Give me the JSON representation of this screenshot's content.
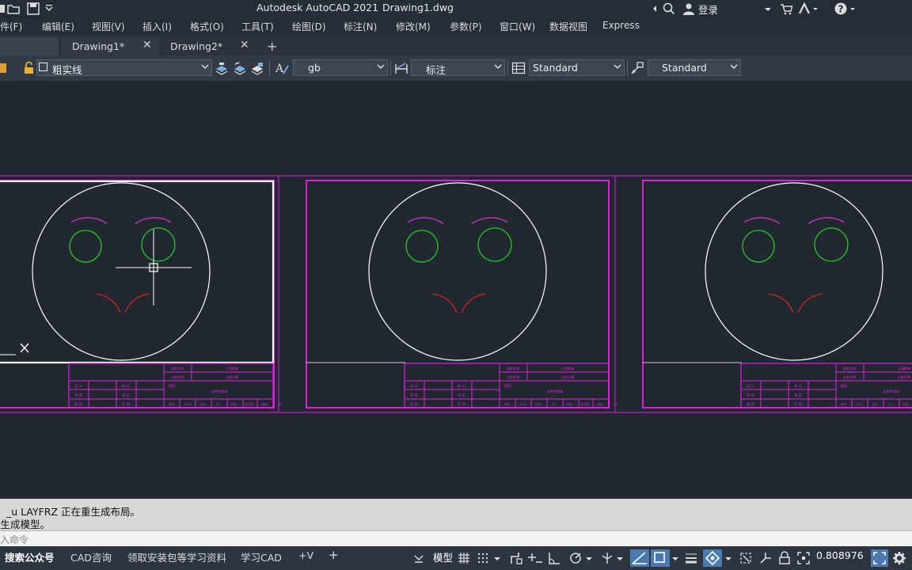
{
  "titlebar": {
    "app_title": "Autodesk AutoCAD 2021",
    "file_name": "Drawing1.dwg",
    "login_label": "登录"
  },
  "menu": {
    "items": [
      "文件(F)",
      "编辑(E)",
      "视图(V)",
      "插入(I)",
      "格式(O)",
      "工具(T)",
      "绘图(D)",
      "标注(N)",
      "修改(M)",
      "参数(P)",
      "窗口(W)",
      "数据视图",
      "Express"
    ]
  },
  "tabs": [
    {
      "label": "Drawing1*",
      "active": true
    },
    {
      "label": "Drawing2*",
      "active": false
    }
  ],
  "toolbar": {
    "layer_value": "粗实线",
    "text_style": "gb",
    "dim_style": "标注",
    "table_style": "Standard",
    "mleader_style": "Standard"
  },
  "drawing": {
    "face_color": "#ffffff",
    "eye_color": "#22cc22",
    "brow_color": "#cc33cc",
    "mouth_color": "#cc2222",
    "frame_color": "#e020e0",
    "title_block": {
      "r1c1": "图纸名称",
      "r1c2": "上海教育",
      "r2c1": "工程名称",
      "r2c2": "工程名称",
      "r3c1": "图纸",
      "r3c2": "笑脸平面图",
      "left_rows": [
        [
          "设 计",
          "校 对"
        ],
        [
          "审 核",
          "审 定"
        ],
        [
          "制 图",
          "比 例"
        ]
      ],
      "bottom": [
        "图号",
        "2024",
        "比例",
        "1:1",
        "阶段",
        "施工图",
        "图幅",
        "A4"
      ]
    }
  },
  "command": {
    "line1": "_u LAYFRZ 正在重生成布局。",
    "line2": "重生成模型。",
    "placeholder": "键入命令"
  },
  "statusbar": {
    "tabs": [
      "搜索公众号",
      "CAD咨询",
      "领取安装包等学习资料",
      "学习CAD",
      "+V"
    ],
    "model_label": "模型",
    "scale_value": "0.808976"
  }
}
